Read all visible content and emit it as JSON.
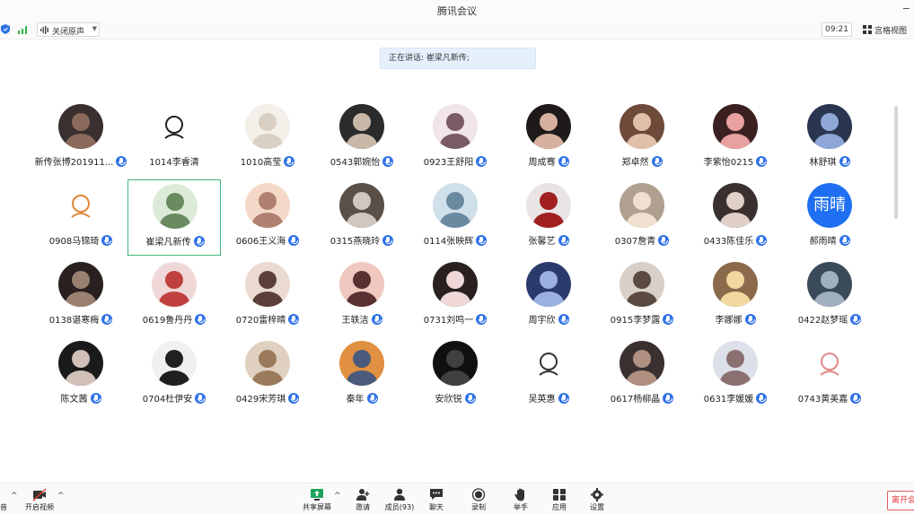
{
  "window": {
    "title": "腾讯会议"
  },
  "toolbar": {
    "mute_label": "关闭原声",
    "time": "09:21",
    "view_label": "宫格视图"
  },
  "speaking": {
    "text": "正在讲话: 崔梁凡新传;"
  },
  "participants": [
    {
      "name": "新传张博201911...",
      "mic": true
    },
    {
      "name": "1014李睿清",
      "mic": false
    },
    {
      "name": "1010高莹",
      "mic": true
    },
    {
      "name": "0543郭婉怡",
      "mic": true
    },
    {
      "name": "0923王舒阳",
      "mic": true
    },
    {
      "name": "周成骞",
      "mic": true
    },
    {
      "name": "郑卓然",
      "mic": true
    },
    {
      "name": "李紫怡0215",
      "mic": true
    },
    {
      "name": "林舒琪",
      "mic": true
    },
    {
      "name": "0908马锦琦",
      "mic": true
    },
    {
      "name": "崔梁凡新传",
      "mic": true
    },
    {
      "name": "0606王义海",
      "mic": true
    },
    {
      "name": "0315燕晓玲",
      "mic": true
    },
    {
      "name": "0114张映辉",
      "mic": true
    },
    {
      "name": "张馨艺",
      "mic": true
    },
    {
      "name": "0307詹青",
      "mic": true
    },
    {
      "name": "0433陈佳乐",
      "mic": true
    },
    {
      "name": "郝雨晴",
      "mic": true,
      "avatar_text": "雨晴"
    },
    {
      "name": "0138谌寒梅",
      "mic": true
    },
    {
      "name": "0619鲁丹丹",
      "mic": true
    },
    {
      "name": "0720雷梓晴",
      "mic": true
    },
    {
      "name": "王轶洁",
      "mic": true
    },
    {
      "name": "0731刘鸣一",
      "mic": true
    },
    {
      "name": "周宇欣",
      "mic": true
    },
    {
      "name": "0915李梦露",
      "mic": true
    },
    {
      "name": "李娜娜",
      "mic": true
    },
    {
      "name": "0422赵梦瑶",
      "mic": true
    },
    {
      "name": "陈文茜",
      "mic": true
    },
    {
      "name": "0704杜伊安",
      "mic": true
    },
    {
      "name": "0429宋芳琪",
      "mic": true
    },
    {
      "name": "秦年",
      "mic": true
    },
    {
      "name": "安欣锐",
      "mic": true
    },
    {
      "name": "吴英惠",
      "mic": true
    },
    {
      "name": "0617杨柳晶",
      "mic": true
    },
    {
      "name": "0631李媛媛",
      "mic": true
    },
    {
      "name": "0743黄美嘉",
      "mic": true
    }
  ],
  "bottombar": {
    "audio_label": "音",
    "video_label": "开启视频",
    "share_label": "共享屏幕",
    "invite_label": "邀请",
    "members_label": "成员(93)",
    "chat_label": "聊天",
    "record_label": "录制",
    "hand_label": "举手",
    "apps_label": "应用",
    "settings_label": "设置",
    "leave_label": "离开会议"
  },
  "colors": {
    "accent": "#1e6ff2",
    "active_border": "#3fb67a",
    "leave": "#e03a3a"
  }
}
